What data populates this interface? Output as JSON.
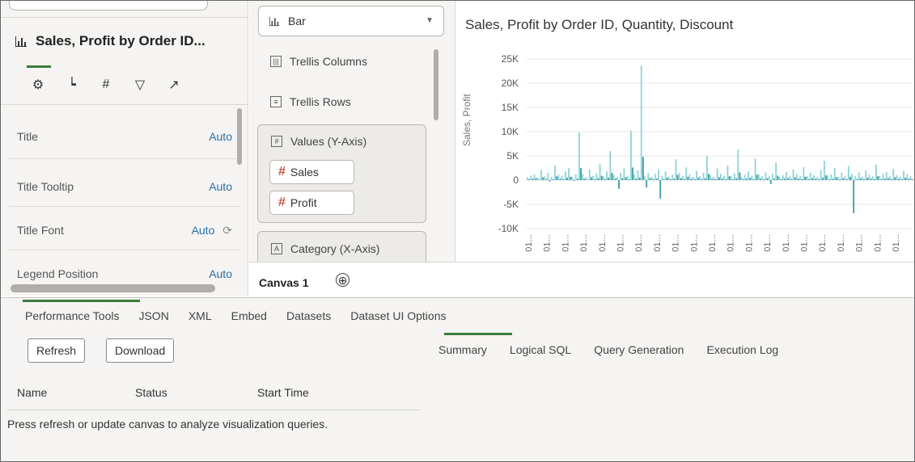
{
  "left_panel": {
    "viz_title": "Sales, Profit by Order ID...",
    "properties": [
      {
        "label": "Title",
        "value": "Auto"
      },
      {
        "label": "Title Tooltip",
        "value": "Auto"
      },
      {
        "label": "Title Font",
        "value": "Auto"
      },
      {
        "label": "Legend Position",
        "value": "Auto"
      }
    ]
  },
  "grammar": {
    "chart_type": "Bar",
    "trellis_columns": "Trellis Columns",
    "trellis_rows": "Trellis Rows",
    "values_label": "Values (Y-Axis)",
    "values_items": [
      "Sales",
      "Profit"
    ],
    "category_label": "Category (X-Axis)"
  },
  "canvas": {
    "tab_label": "Canvas 1",
    "add_symbol": "⊕"
  },
  "chart_data": {
    "type": "bar",
    "title": "Sales, Profit by Order ID, Quantity, Discount",
    "xlabel": "",
    "ylabel": "Sales, Profit",
    "ylim": [
      -10000,
      25000
    ],
    "y_ticks": [
      "25K",
      "20K",
      "15K",
      "10K",
      "5K",
      "0",
      "-5K",
      "-10K"
    ],
    "x_tick_label": "01...",
    "series": [
      {
        "name": "Sales",
        "color": "#8fd3d6",
        "values": [
          600,
          900,
          1200,
          500,
          2100,
          800,
          1500,
          700,
          3000,
          1100,
          900,
          1800,
          2500,
          700,
          1200,
          9800,
          1300,
          600,
          2200,
          900,
          1400,
          3400,
          800,
          1800,
          6000,
          1100,
          700,
          1500,
          2400,
          900,
          10200,
          1200,
          2000,
          23600,
          800,
          1500,
          700,
          1300,
          2200,
          900,
          1800,
          700,
          1100,
          4300,
          1500,
          900,
          2600,
          1200,
          700,
          1900,
          800,
          1500,
          5000,
          1100,
          700,
          2400,
          1300,
          900,
          3000,
          800,
          1400,
          6300,
          700,
          1100,
          1800,
          900,
          4400,
          1200,
          800,
          1600,
          900,
          1300,
          3600,
          700,
          1000,
          1700,
          800,
          2200,
          1200,
          900,
          2700,
          800,
          1500,
          1000,
          700,
          2100,
          4000,
          900,
          1200,
          2500,
          700,
          1500,
          800,
          2900,
          1300,
          900,
          1600,
          700,
          2000,
          1100,
          800,
          3200,
          900,
          1300,
          1700,
          800,
          2300,
          1000,
          700,
          1900,
          1200,
          800
        ]
      },
      {
        "name": "Profit",
        "color": "#3d9aa8",
        "values": [
          200,
          300,
          400,
          100,
          600,
          200,
          -300,
          200,
          800,
          300,
          200,
          500,
          700,
          -200,
          300,
          2500,
          300,
          100,
          600,
          200,
          400,
          900,
          200,
          500,
          1500,
          300,
          -1800,
          400,
          600,
          200,
          2600,
          300,
          500,
          4800,
          -1500,
          400,
          200,
          300,
          -3800,
          200,
          500,
          200,
          300,
          1100,
          400,
          200,
          700,
          300,
          200,
          500,
          200,
          400,
          1300,
          300,
          200,
          600,
          300,
          200,
          800,
          200,
          400,
          1600,
          200,
          300,
          500,
          200,
          1100,
          300,
          200,
          400,
          -800,
          300,
          900,
          200,
          300,
          400,
          200,
          600,
          300,
          200,
          700,
          200,
          400,
          300,
          200,
          500,
          1000,
          200,
          300,
          600,
          200,
          400,
          200,
          700,
          -6800,
          200,
          400,
          200,
          500,
          300,
          200,
          800,
          200,
          300,
          400,
          200,
          600,
          300,
          200,
          500,
          300,
          200
        ]
      }
    ]
  },
  "bottom_panel": {
    "tool_tabs": [
      "Performance Tools",
      "JSON",
      "XML",
      "Embed",
      "Datasets",
      "Dataset UI Options"
    ],
    "refresh_label": "Refresh",
    "download_label": "Download",
    "sub_tabs": [
      "Summary",
      "Logical SQL",
      "Query Generation",
      "Execution Log"
    ],
    "columns": [
      "Name",
      "Status",
      "Start Time"
    ],
    "message": "Press refresh or update canvas to analyze visualization queries."
  },
  "colors": {
    "accent": "#3c7a3c",
    "link": "#2a6ea8",
    "hash": "#c0533b"
  }
}
